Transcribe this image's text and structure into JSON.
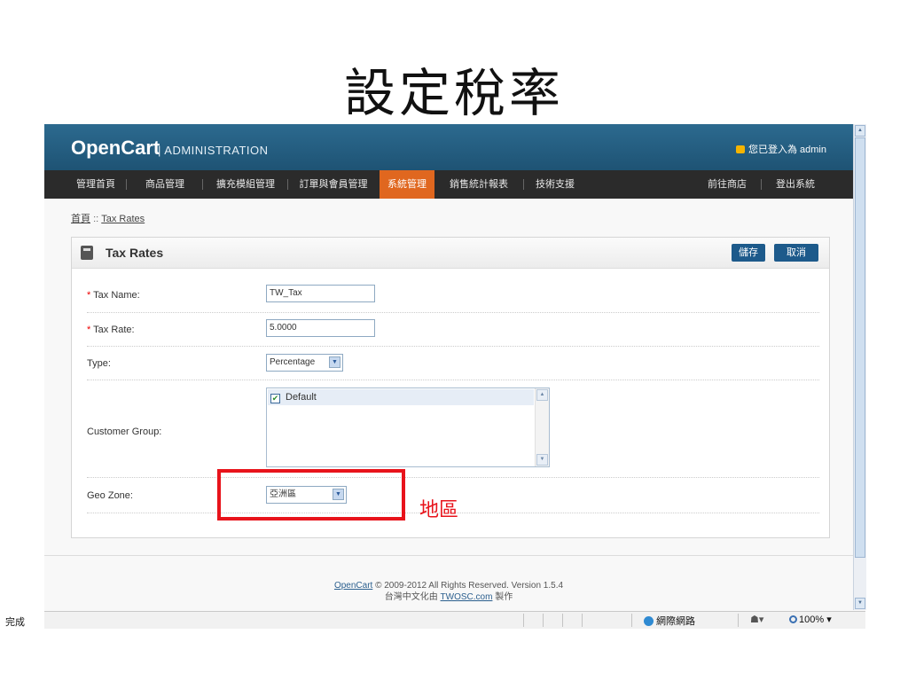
{
  "slide": {
    "title": "設定稅率"
  },
  "header": {
    "logo": "OpenCart",
    "logo_sub": "| ADMINISTRATION",
    "login_info": "您已登入為 admin"
  },
  "menu": {
    "left": [
      "管理首頁",
      "商品管理",
      "擴充模組管理",
      "訂單與會員管理",
      "系統管理",
      "銷售統計報表",
      "技術支援"
    ],
    "right": [
      "前往商店",
      "登出系統"
    ],
    "active": "系統管理"
  },
  "breadcrumb": {
    "home": "首頁",
    "separator": "::",
    "current": "Tax Rates"
  },
  "form": {
    "title": "Tax Rates",
    "save_label": "儲存",
    "cancel_label": "取消",
    "tax_name": {
      "label": "Tax Name:",
      "value": "TW_Tax"
    },
    "tax_rate": {
      "label": "Tax Rate:",
      "value": "5.0000"
    },
    "type": {
      "label": "Type:",
      "value": "Percentage"
    },
    "customer_group": {
      "label": "Customer Group:",
      "items": [
        {
          "label": "Default",
          "checked": true
        }
      ]
    },
    "geo_zone": {
      "label": "Geo Zone:",
      "value": "亞洲區"
    }
  },
  "annotation": {
    "text": "地區",
    "color": "#e8131b"
  },
  "footer": {
    "line1_link": "OpenCart",
    "line1_text": "© 2009-2012 All Rights Reserved. Version 1.5.4",
    "line2_prefix": "台灣中文化由",
    "line2_link": "TWOSC.com",
    "line2_suffix": "製作"
  },
  "statusbar": {
    "status": "完成",
    "zone": "網際網路",
    "zoom": "100%"
  },
  "colors": {
    "header": "#1e5374",
    "menu_active": "#e0671f",
    "button": "#1d5a8b"
  }
}
